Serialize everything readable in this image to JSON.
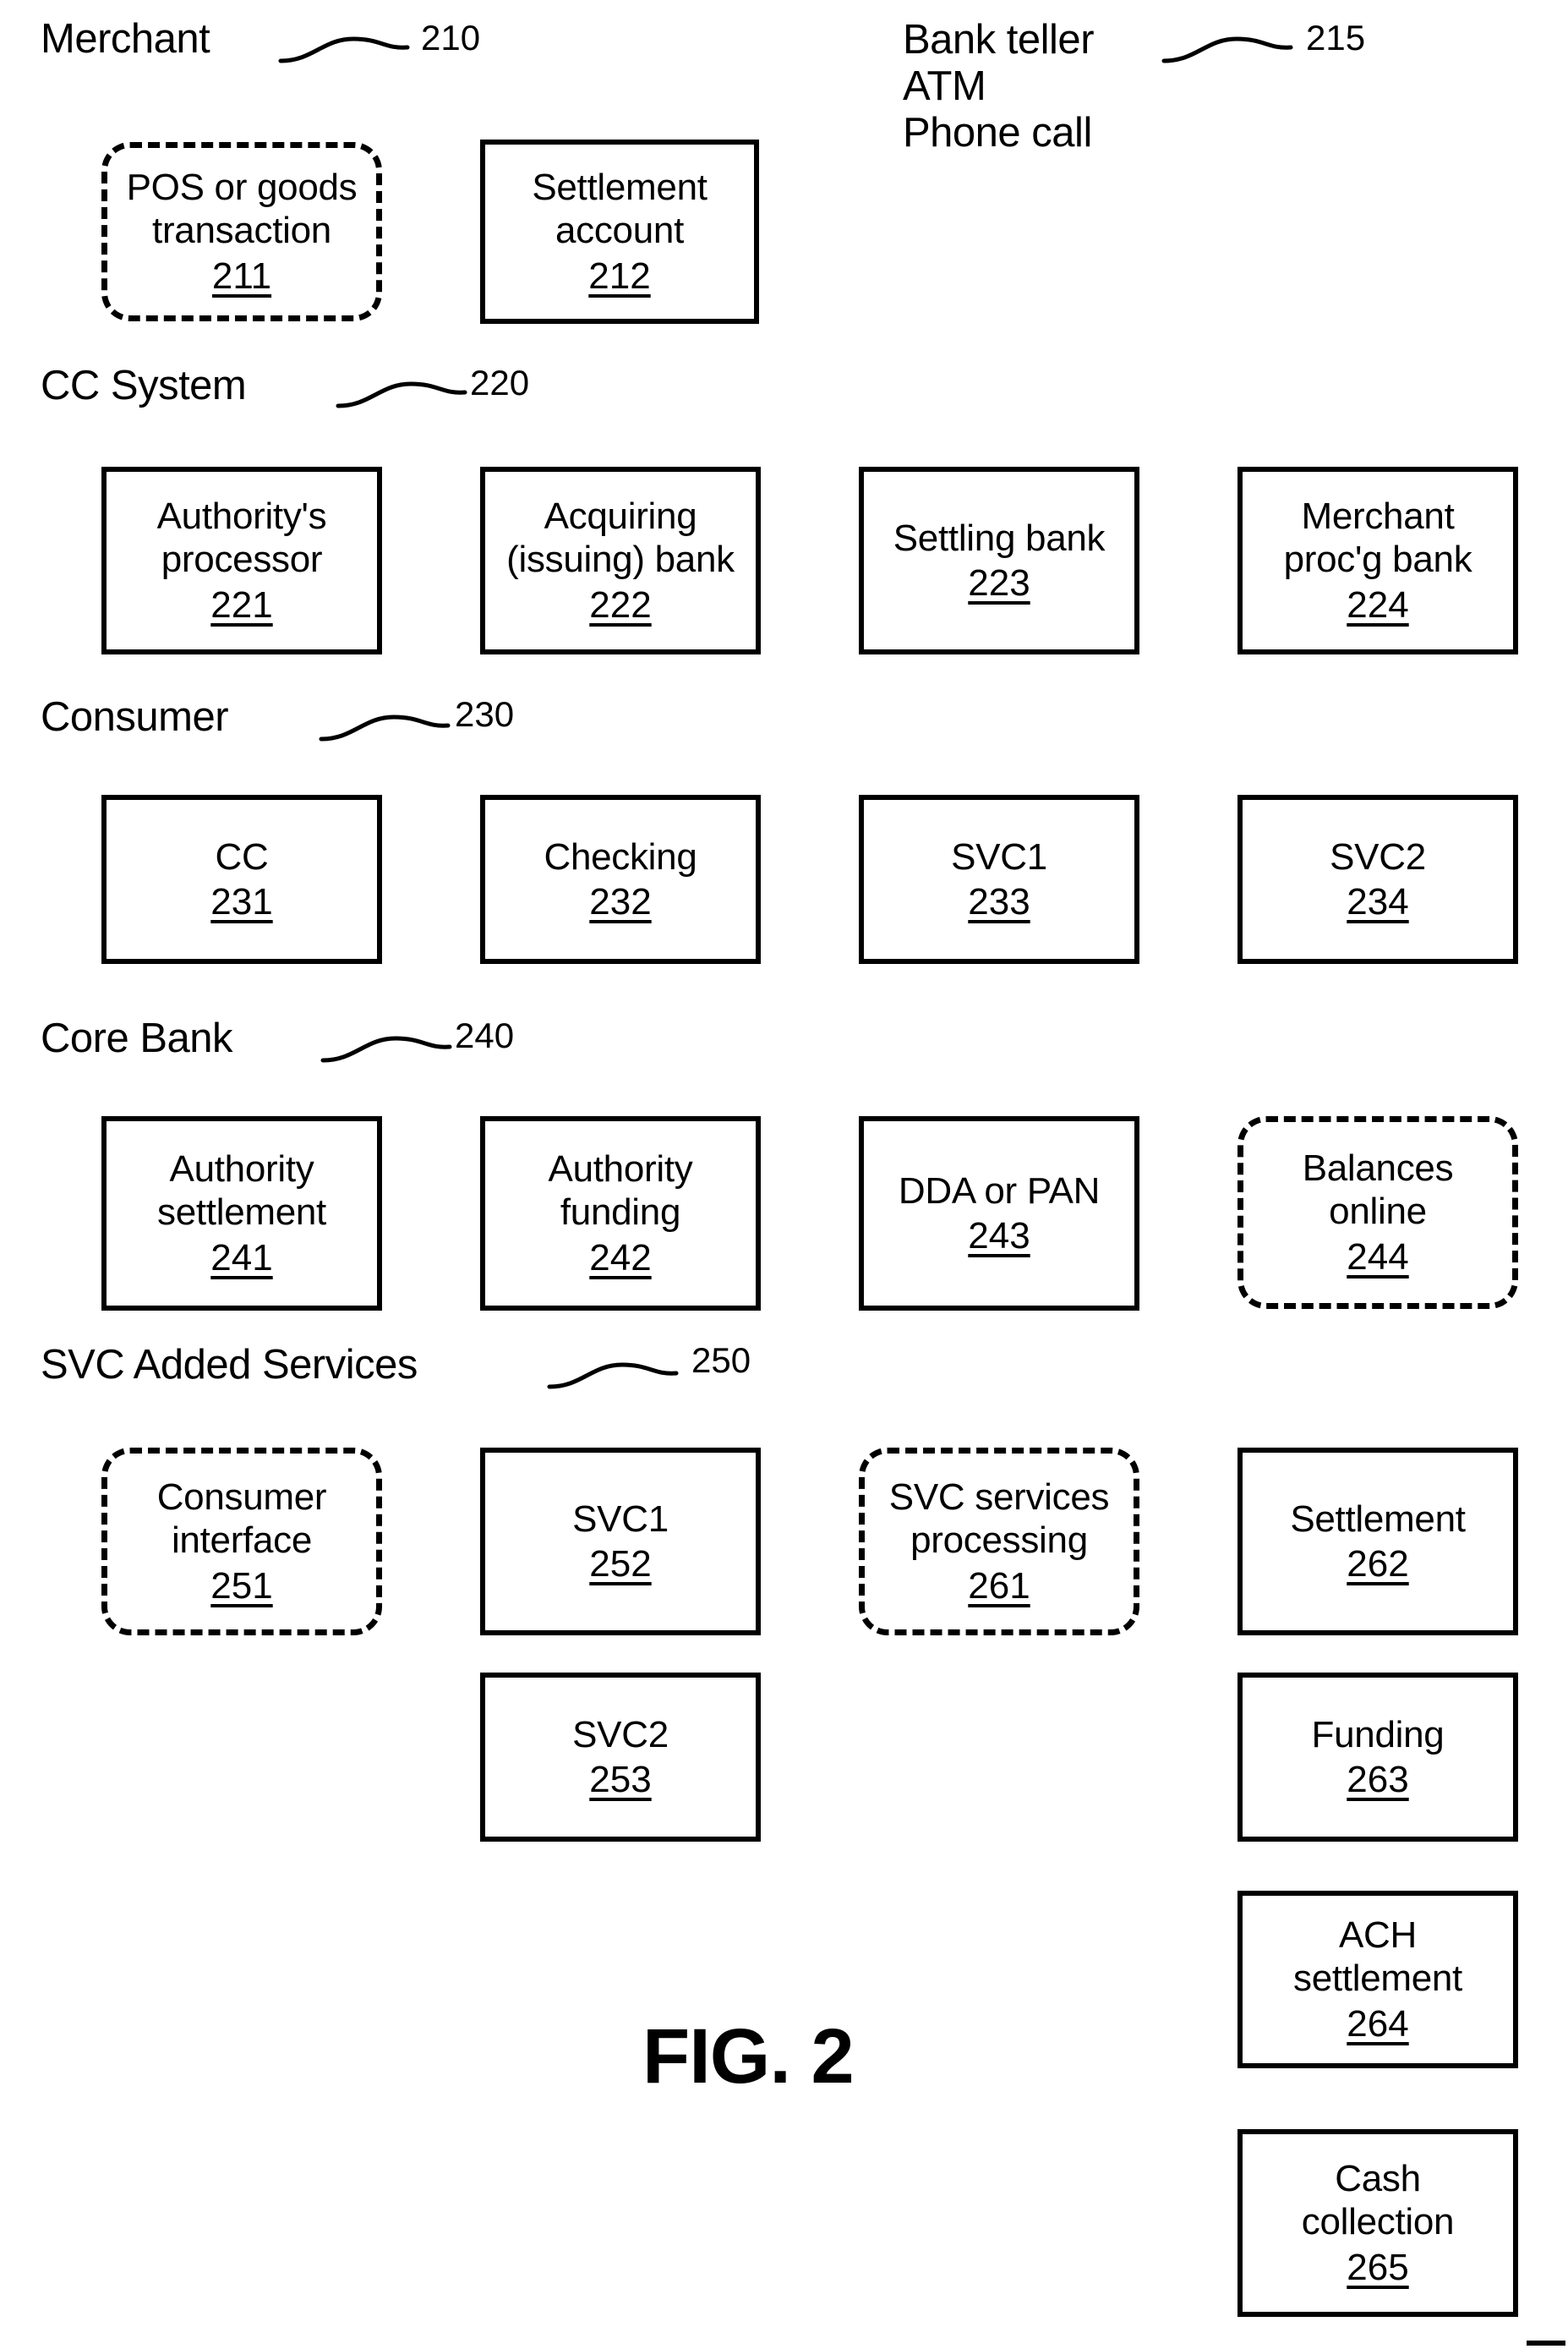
{
  "figure": {
    "caption": "FIG. 2"
  },
  "sections": [
    {
      "label": "Merchant",
      "ref": "210"
    },
    {
      "label": "CC System",
      "ref": "220"
    },
    {
      "label": "Consumer",
      "ref": "230"
    },
    {
      "label": "Core Bank",
      "ref": "240"
    },
    {
      "label": "SVC Added Services",
      "ref": "250"
    }
  ],
  "channels": {
    "lines": "Bank teller\nATM\nPhone call",
    "ref": "215"
  },
  "boxes": {
    "b211": {
      "text": "POS or goods\ntransaction",
      "num": "211",
      "style": "dashed"
    },
    "b212": {
      "text": "Settlement\naccount",
      "num": "212",
      "style": "solid"
    },
    "b221": {
      "text": "Authority's\nprocessor",
      "num": "221",
      "style": "solid"
    },
    "b222": {
      "text": "Acquiring\n(issuing) bank",
      "num": "222",
      "style": "solid"
    },
    "b223": {
      "text": "Settling bank",
      "num": "223",
      "style": "solid"
    },
    "b224": {
      "text": "Merchant\nproc'g bank",
      "num": "224",
      "style": "solid"
    },
    "b231": {
      "text": "CC",
      "num": "231",
      "style": "solid"
    },
    "b232": {
      "text": "Checking",
      "num": "232",
      "style": "solid"
    },
    "b233": {
      "text": "SVC1",
      "num": "233",
      "style": "solid"
    },
    "b234": {
      "text": "SVC2",
      "num": "234",
      "style": "solid"
    },
    "b241": {
      "text": "Authority\nsettlement",
      "num": "241",
      "style": "solid"
    },
    "b242": {
      "text": "Authority\nfunding",
      "num": "242",
      "style": "solid"
    },
    "b243": {
      "text": "DDA or PAN",
      "num": "243",
      "style": "solid"
    },
    "b244": {
      "text": "Balances\nonline",
      "num": "244",
      "style": "dashed"
    },
    "b251": {
      "text": "Consumer\ninterface",
      "num": "251",
      "style": "dashed"
    },
    "b252": {
      "text": "SVC1",
      "num": "252",
      "style": "solid"
    },
    "b253": {
      "text": "SVC2",
      "num": "253",
      "style": "solid"
    },
    "b261": {
      "text": "SVC services\nprocessing",
      "num": "261",
      "style": "dashed"
    },
    "b262": {
      "text": "Settlement",
      "num": "262",
      "style": "solid"
    },
    "b263": {
      "text": "Funding",
      "num": "263",
      "style": "solid"
    },
    "b264": {
      "text": "ACH\nsettlement",
      "num": "264",
      "style": "solid"
    },
    "b265": {
      "text": "Cash\ncollection",
      "num": "265",
      "style": "solid"
    }
  },
  "colors": {
    "ink": "#000000",
    "page": "#ffffff"
  }
}
